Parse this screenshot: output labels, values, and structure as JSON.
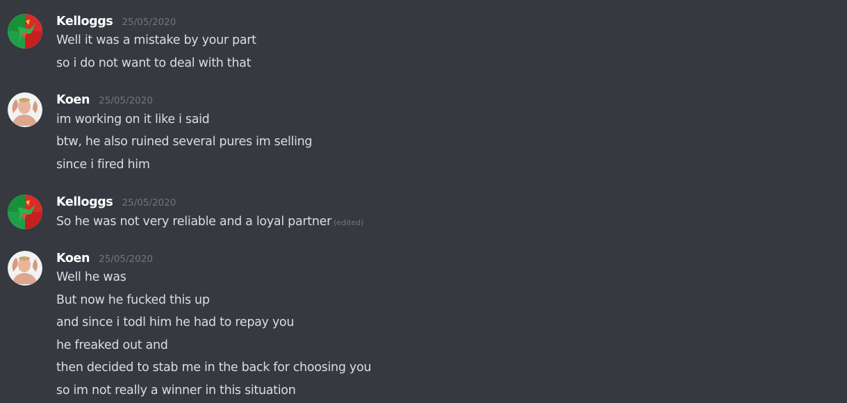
{
  "messages": [
    {
      "username": "Kelloggs",
      "timestamp": "25/05/2020",
      "avatar_icon": "kelloggs-rooster-icon",
      "lines": [
        "Well it was a mistake by your part",
        "so i do not want to deal with that"
      ]
    },
    {
      "username": "Koen",
      "timestamp": "25/05/2020",
      "avatar_icon": "koen-flexing-photo-icon",
      "lines": [
        "im working on it like i said",
        "btw, he also ruined several pures im selling",
        "since i fired him"
      ]
    },
    {
      "username": "Kelloggs",
      "timestamp": "25/05/2020",
      "avatar_icon": "kelloggs-rooster-icon",
      "lines": [
        "So he was not very reliable and a loyal partner"
      ],
      "edited_label": "(edited)"
    },
    {
      "username": "Koen",
      "timestamp": "25/05/2020",
      "avatar_icon": "koen-flexing-photo-icon",
      "lines": [
        "Well he was",
        "But now he fucked this up",
        "and since i todl him he had to repay you",
        "he freaked out and",
        "then decided to stab me in the back for choosing you",
        "so im not really a winner in this situation"
      ]
    }
  ],
  "colors": {
    "background": "#36393f",
    "username": "#ffffff",
    "message_text": "#dcddde",
    "timestamp": "#72767d"
  }
}
